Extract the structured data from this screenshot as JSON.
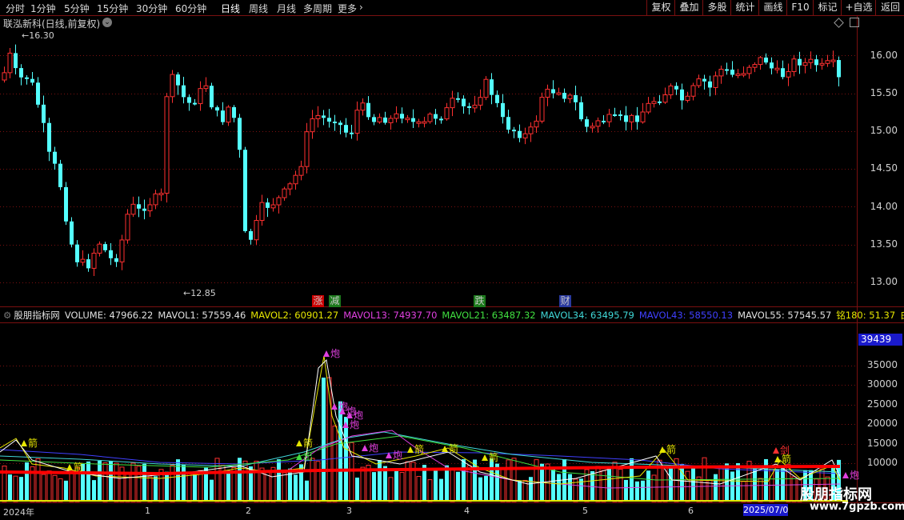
{
  "toolbar": {
    "timeframes": [
      "分时",
      "1分钟",
      "5分钟",
      "15分钟",
      "30分钟",
      "60分钟",
      "日线",
      "周线",
      "月线",
      "多周期",
      "更多"
    ],
    "more_chevron": "›",
    "right_buttons": [
      "复权",
      "叠加",
      "多股",
      "统计",
      "画线",
      "F10",
      "标记",
      "+自选",
      "返回"
    ]
  },
  "chart": {
    "title": "联泓新科(日线,前复权)",
    "title_chevron": "⌄",
    "high_label": "16.30",
    "low_label": "12.85",
    "price_axis": [
      "16.00",
      "15.50",
      "15.00",
      "14.50",
      "14.00",
      "13.50",
      "13.00"
    ],
    "events": [
      {
        "text": "涨",
        "color": "#e8e8e8",
        "bg": "#cc0000"
      },
      {
        "text": "减",
        "color": "#e8e8e8",
        "bg": "#1c7a1c"
      },
      {
        "text": "跌",
        "color": "#e8e8e8",
        "bg": "#1c7a1c"
      },
      {
        "text": "财",
        "color": "#e8e8e8",
        "bg": "#2a3aa0"
      }
    ]
  },
  "indicator": {
    "name": "股朋指标网",
    "items": [
      {
        "text": "VOLUME: 47966.22",
        "color": "#e0e0e0"
      },
      {
        "text": "MAVOL1: 57559.46",
        "color": "#e0e0e0"
      },
      {
        "text": "MAVOL2: 60901.27",
        "color": "#e6e600"
      },
      {
        "text": "MAVOL13: 74937.70",
        "color": "#e040e0"
      },
      {
        "text": "MAVOL21: 63487.32",
        "color": "#40e040"
      },
      {
        "text": "MAVOL34: 63495.79",
        "color": "#40d8d8"
      },
      {
        "text": "MAVOL43: 58550.13",
        "color": "#4040ff"
      },
      {
        "text": "MAVOL55: 57545.57",
        "color": "#e0e0e0"
      },
      {
        "text": "铭180: 51.37",
        "color": "#e6e600"
      },
      {
        "text": "白",
        "color": "#e6e600"
      }
    ],
    "current_value": "39439",
    "vol_axis": [
      "35000",
      "30000",
      "25000",
      "20000",
      "15000",
      "10000"
    ],
    "signals": {
      "arrow": "箭",
      "cannon": "炮",
      "sword": "剑",
      "out": "出"
    }
  },
  "dates": {
    "labels": [
      "2024年",
      "1",
      "2",
      "3",
      "4",
      "5",
      "6"
    ],
    "current": "2025/07/0"
  },
  "watermark": {
    "text": "股朋指标网",
    "url": "www.7gpzb.com"
  },
  "colors": {
    "up": "#ff3030",
    "down": "#54ffff",
    "grid": "#7a1010",
    "ma_red": "#ff0000"
  }
}
